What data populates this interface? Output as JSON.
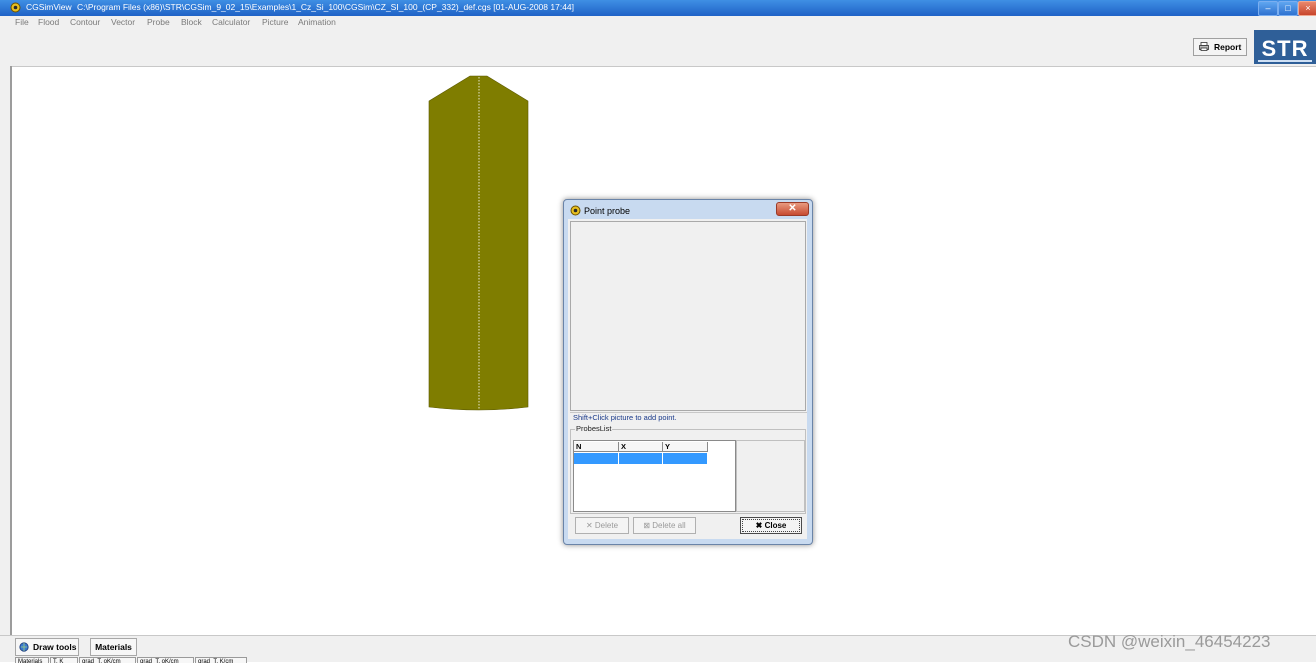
{
  "window": {
    "app_name": "CGSimView",
    "path": "C:\\Program Files (x86)\\STR\\CGSim_9_02_15\\Examples\\1_Cz_Si_100\\CGSim\\CZ_SI_100_(CP_332)_def.cgs  [01-AUG-2008  17:44]",
    "min_symbol": "–",
    "max_symbol": "□",
    "close_symbol": "×"
  },
  "menu": [
    "File",
    "Flood",
    "Contour",
    "Vector",
    "Probe",
    "Block",
    "Calculator",
    "Picture",
    "Animation"
  ],
  "toolbar": {
    "report_label": "Report",
    "logo_text": "STR"
  },
  "canvas": {
    "crystal_color": "#7f7d00"
  },
  "dialog": {
    "title": "Point probe",
    "close_symbol": "✕",
    "hint": "Shift+Click picture to add point.",
    "group_label": "ProbesList",
    "columns": [
      "N",
      "X",
      "Y"
    ],
    "buttons": {
      "delete": "Delete",
      "delete_all": "Delete all",
      "close": "Close"
    }
  },
  "bottom_tabs": {
    "draw_tools": "Draw tools",
    "materials": "Materials"
  },
  "sub_tabs": [
    "Materials",
    "T, K",
    "grad_T, oK/cm",
    "grad_T, oK/cm",
    "grad_T, K/cm"
  ],
  "watermark": "CSDN @weixin_46454223",
  "colors": {
    "title_bar": "#2f72d0",
    "selection": "#3399ff",
    "logo_bg": "#2f5f98"
  }
}
